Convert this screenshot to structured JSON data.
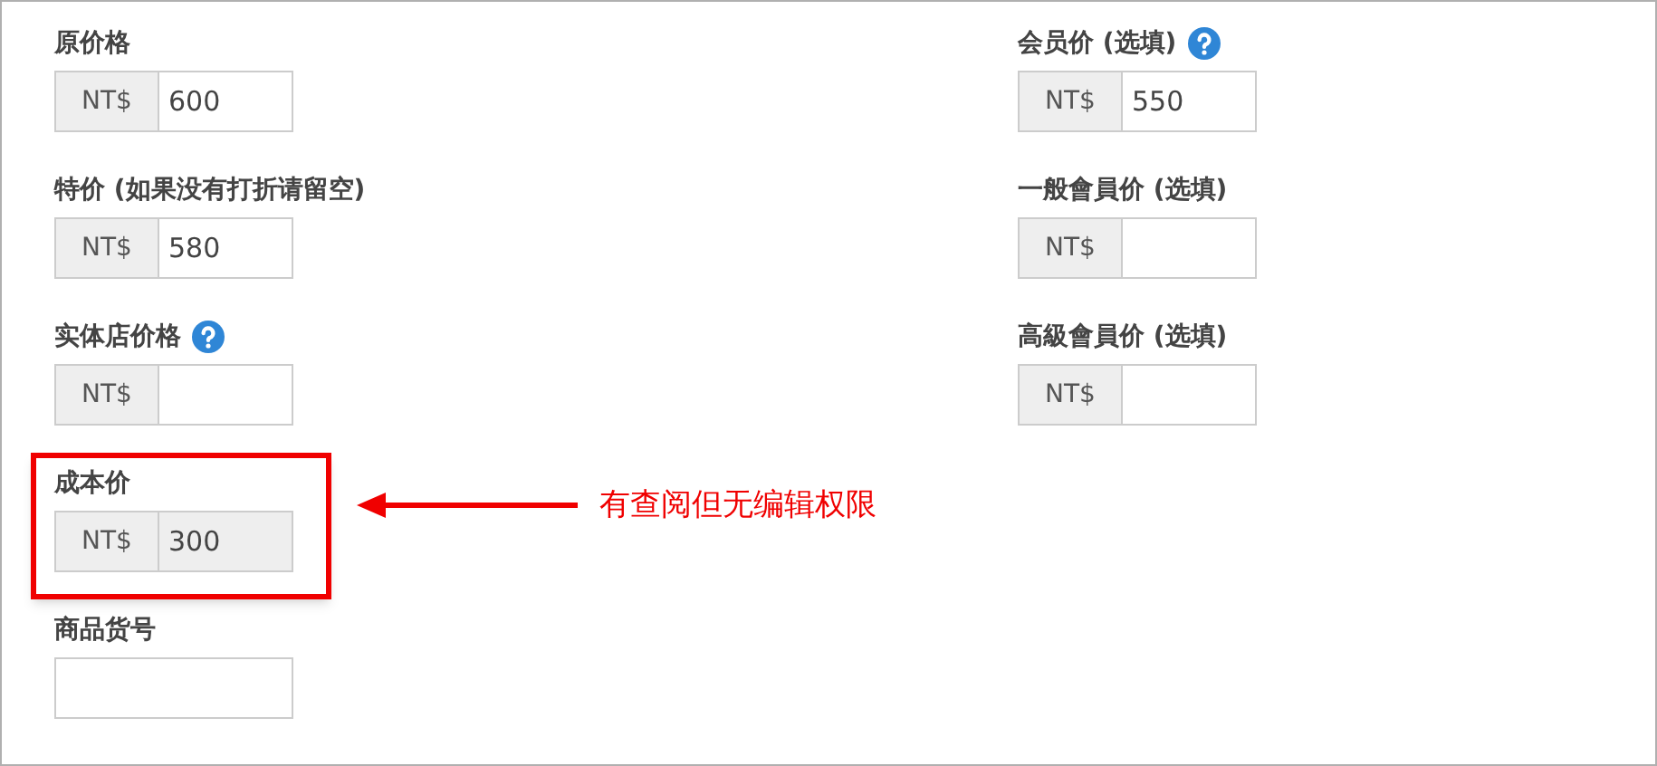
{
  "left_fields": [
    {
      "label": "原价格",
      "kind": "currency",
      "prefix": "NT$",
      "value": "600",
      "help": false,
      "disabled": false,
      "highlighted": false
    },
    {
      "label": "特价 (如果没有打折请留空)",
      "kind": "currency",
      "prefix": "NT$",
      "value": "580",
      "help": false,
      "disabled": false,
      "highlighted": false
    },
    {
      "label": "实体店价格",
      "kind": "currency",
      "prefix": "NT$",
      "help": true,
      "disabled": false,
      "highlighted": false
    },
    {
      "label": "成本价",
      "kind": "currency",
      "prefix": "NT$",
      "value": "300",
      "help": false,
      "disabled": true,
      "highlighted": true
    },
    {
      "label": "商品货号",
      "kind": "text",
      "help": false,
      "disabled": false,
      "highlighted": false
    }
  ],
  "right_fields": [
    {
      "label": "会员价 (选填)",
      "kind": "currency",
      "prefix": "NT$",
      "value": "550",
      "help": true,
      "disabled": false,
      "highlighted": false
    },
    {
      "label": "一般會員价 (选填)",
      "kind": "currency",
      "prefix": "NT$",
      "help": false,
      "disabled": false,
      "highlighted": false
    },
    {
      "label": "高級會員价 (选填)",
      "kind": "currency",
      "prefix": "NT$",
      "help": false,
      "disabled": false,
      "highlighted": false
    }
  ],
  "annotation": {
    "text": "有查阅但无编辑权限"
  }
}
